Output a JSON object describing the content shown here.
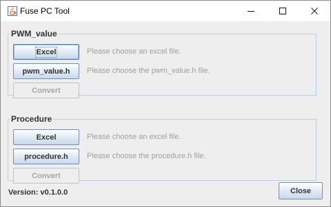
{
  "window": {
    "title": "Fuse PC Tool",
    "controls": {
      "minimize": "minimize-icon",
      "maximize": "maximize-icon",
      "close": "close-icon"
    }
  },
  "pwm_group": {
    "legend": "PWM_value",
    "excel_button": "Excel",
    "excel_hint": "Please choose an excel file.",
    "header_button": "pwm_value.h",
    "header_hint": "Please choose the pwm_value.h file.",
    "convert_button": "Convert"
  },
  "procedure_group": {
    "legend": "Procedure",
    "excel_button": "Excel",
    "excel_hint": "Please choose an excel file.",
    "header_button": "procedure.h",
    "header_hint": "Please choose the procedure.h file.",
    "convert_button": "Convert"
  },
  "footer": {
    "version": "Version: v0.1.0.0",
    "close_button": "Close"
  },
  "colors": {
    "group_border": "#b8cfe5",
    "hint_text": "#9f9f9f",
    "button_gradient_bottom": "#c7d9ec"
  }
}
